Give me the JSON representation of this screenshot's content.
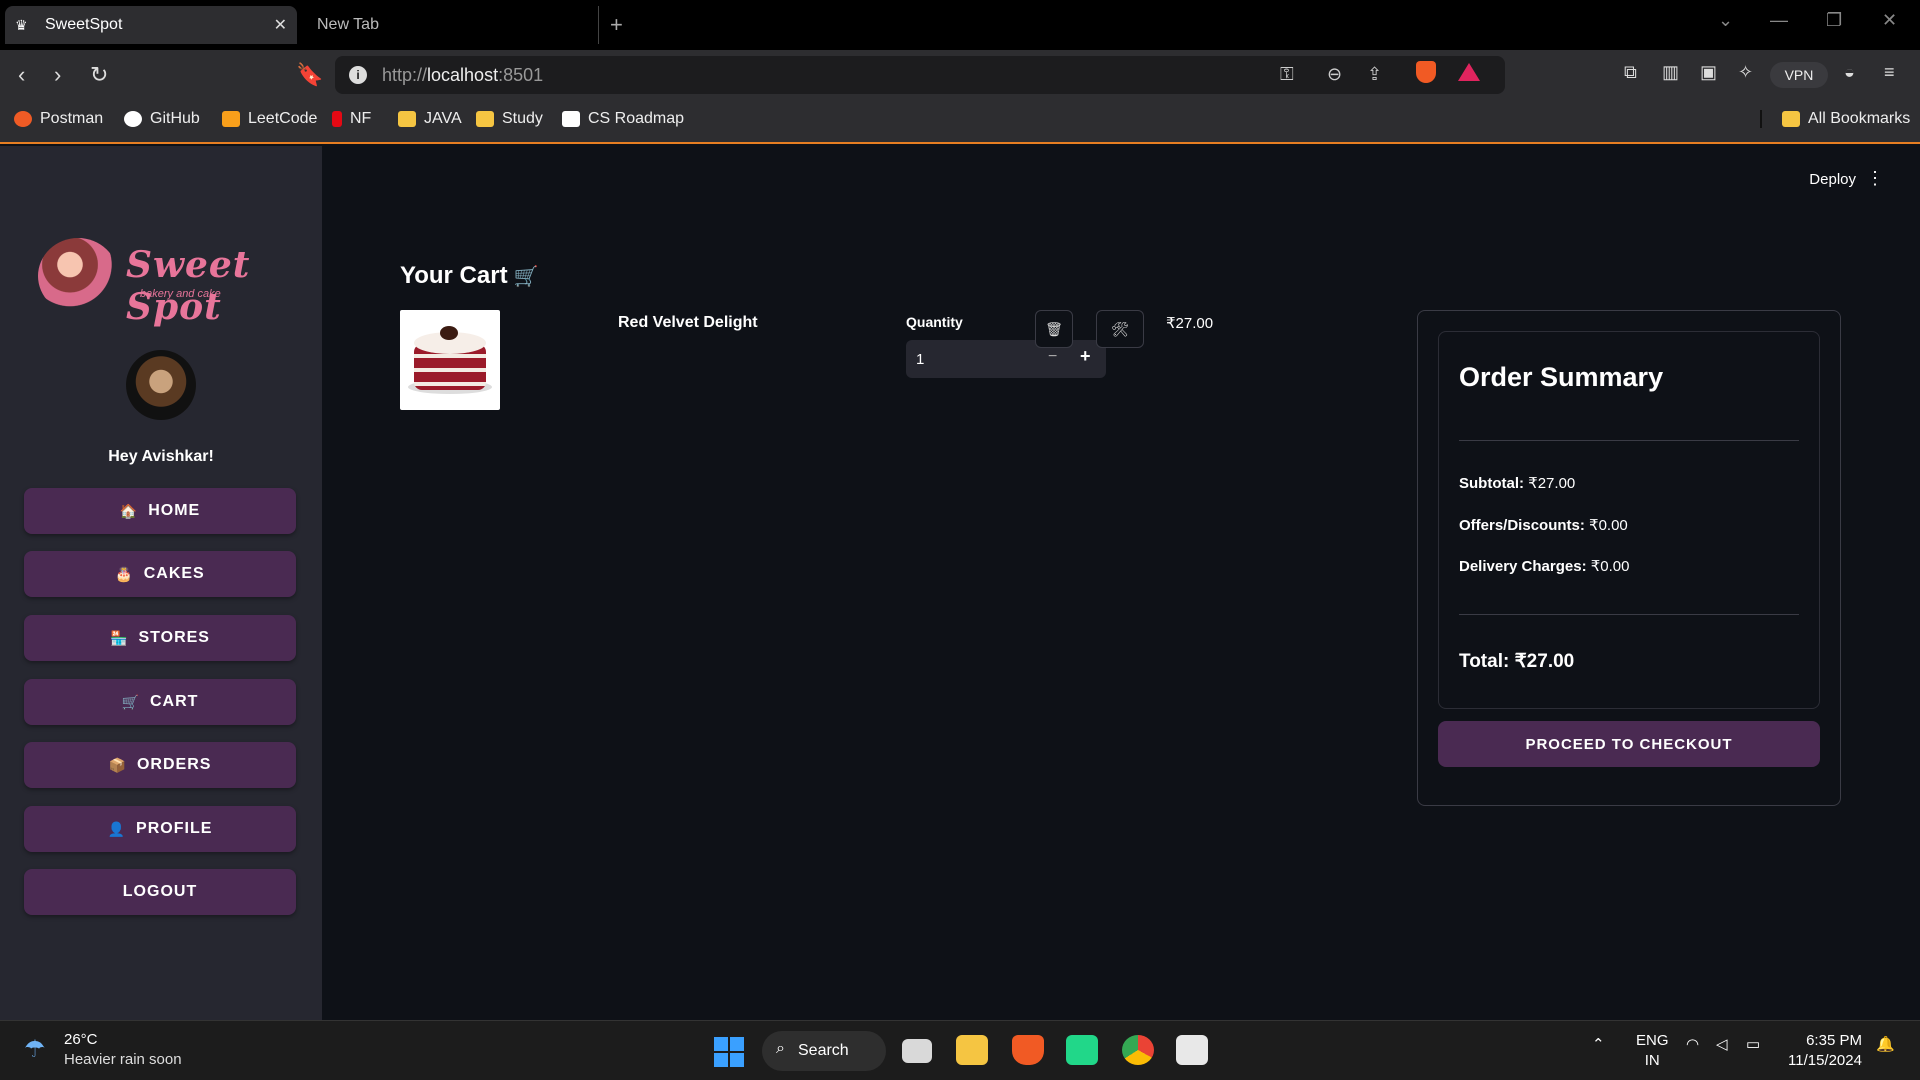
{
  "browser": {
    "active_tab_title": "SweetSpot",
    "inactive_tab_title": "New Tab",
    "url_host": "localhost",
    "url_prefix": "http://",
    "url_port": ":8501",
    "vpn_label": "VPN",
    "bookmarks": [
      "Postman",
      "GitHub",
      "LeetCode",
      "NF",
      "JAVA",
      "Study",
      "CS Roadmap"
    ],
    "all_bookmarks": "All Bookmarks"
  },
  "sidebar": {
    "logo_name": "Sweet Spot",
    "logo_tagline": "bakery and cake",
    "greeting": "Hey Avishkar!",
    "items": [
      {
        "label": "HOME",
        "emoji": "🏠"
      },
      {
        "label": "CAKES",
        "emoji": "🎂"
      },
      {
        "label": "STORES",
        "emoji": "🏪"
      },
      {
        "label": "CART",
        "emoji": "🛒"
      },
      {
        "label": "ORDERS",
        "emoji": "📦"
      },
      {
        "label": "PROFILE",
        "emoji": "👤"
      },
      {
        "label": "LOGOUT",
        "emoji": ""
      }
    ]
  },
  "header": {
    "deploy_label": "Deploy",
    "menu_icon": "⋮"
  },
  "cart": {
    "title": "Your Cart",
    "title_icon": "🛒",
    "item": {
      "name": "Red Velvet Delight",
      "quantity_label": "Quantity",
      "quantity_value": "1",
      "price": "₹27.00",
      "delete_icon": "🗑",
      "edit_icon": "🛠"
    }
  },
  "summary": {
    "title": "Order Summary",
    "subtotal_label": "Subtotal:",
    "subtotal_value": "₹27.00",
    "discount_label": "Offers/Discounts:",
    "discount_value": "₹0.00",
    "delivery_label": "Delivery Charges:",
    "delivery_value": "₹0.00",
    "total_label": "Total:",
    "total_value": "₹27.00",
    "checkout_label": "PROCEED TO CHECKOUT"
  },
  "taskbar": {
    "temperature": "26°C",
    "weather_status": "Heavier rain soon",
    "search_label": "Search",
    "lang_top": "ENG",
    "lang_bottom": "IN",
    "time": "6:35 PM",
    "date": "11/15/2024"
  },
  "colors": {
    "accent_button": "#4a2a52",
    "sidebar_bg": "#262730",
    "main_bg": "#0e1117",
    "logo_pink": "#e8759a"
  }
}
